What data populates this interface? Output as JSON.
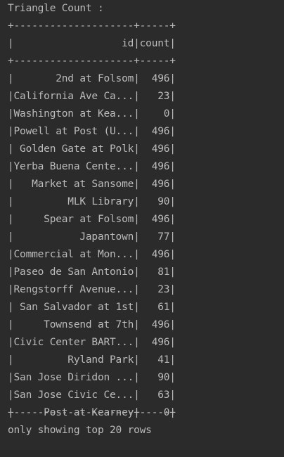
{
  "console": {
    "header": "Triangle Count :",
    "border": "+--------------------+-----+",
    "table": {
      "columns": [
        "id",
        "count"
      ],
      "rows": [
        {
          "id": "2nd at Folsom",
          "count": "496"
        },
        {
          "id": "California Ave Ca...",
          "count": "23"
        },
        {
          "id": "Washington at Kea...",
          "count": "0"
        },
        {
          "id": "Powell at Post (U...",
          "count": "496"
        },
        {
          "id": "Golden Gate at Polk",
          "count": "496"
        },
        {
          "id": "Yerba Buena Cente...",
          "count": "496"
        },
        {
          "id": "Market at Sansome",
          "count": "496"
        },
        {
          "id": "MLK Library",
          "count": "90"
        },
        {
          "id": "Spear at Folsom",
          "count": "496"
        },
        {
          "id": "Japantown",
          "count": "77"
        },
        {
          "id": "Commercial at Mon...",
          "count": "496"
        },
        {
          "id": "Paseo de San Antonio",
          "count": "81"
        },
        {
          "id": "Rengstorff Avenue...",
          "count": "23"
        },
        {
          "id": "San Salvador at 1st",
          "count": "61"
        },
        {
          "id": "Townsend at 7th",
          "count": "496"
        },
        {
          "id": "Civic Center BART...",
          "count": "496"
        },
        {
          "id": "Ryland Park",
          "count": "41"
        },
        {
          "id": "San Jose Diridon ...",
          "count": "90"
        },
        {
          "id": "San Jose Civic Ce...",
          "count": "63"
        },
        {
          "id": "Post at Kearney",
          "count": "0"
        }
      ]
    },
    "footer": "only showing top 20 rows"
  }
}
